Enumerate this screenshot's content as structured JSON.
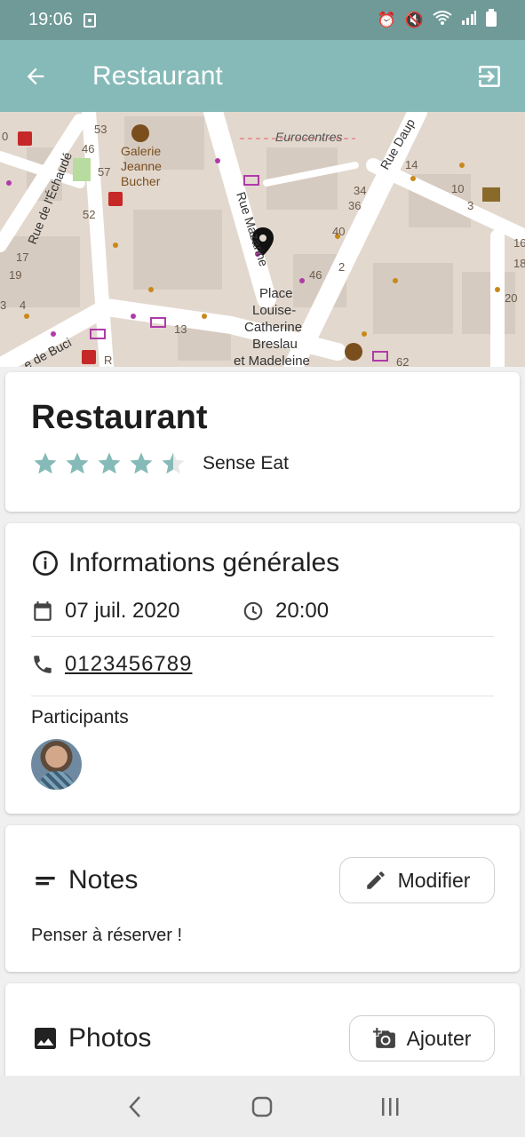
{
  "status_bar": {
    "time": "19:06"
  },
  "app_bar": {
    "title": "Restaurant"
  },
  "map": {
    "labels": {
      "gallery": "Galerie\nJeanne\nBucher",
      "eurocentres": "Eurocentres",
      "rue_mazarine": "Rue Mazarine",
      "rue_echaude": "Rue de l'Échaudé",
      "rue_dauphine": "Rue Daup",
      "rue_buci": "e de Buci",
      "place": "Place\nLouise-\nCatherine\nBreslau\net Madeleine",
      "numbers": [
        "53",
        "46",
        "57",
        "52",
        "0",
        "4",
        "14",
        "10",
        "3",
        "34",
        "36",
        "40",
        "46",
        "2",
        "16",
        "17",
        "19",
        "18",
        "20",
        "3",
        "4",
        "13",
        "62",
        "R"
      ]
    }
  },
  "place": {
    "title": "Restaurant",
    "rating": 4.5,
    "rating_max": 5,
    "subtitle": "Sense Eat"
  },
  "info": {
    "heading": "Informations générales",
    "date": "07 juil. 2020",
    "time": "20:00",
    "phone": "0123456789",
    "participants_label": "Participants"
  },
  "notes": {
    "heading": "Notes",
    "edit_label": "Modifier",
    "text": "Penser à réserver !"
  },
  "photos": {
    "heading": "Photos",
    "add_label": "Ajouter"
  },
  "colors": {
    "status_bar": "#6f9a98",
    "app_bar": "#86bab8",
    "star": "#86bab8"
  }
}
